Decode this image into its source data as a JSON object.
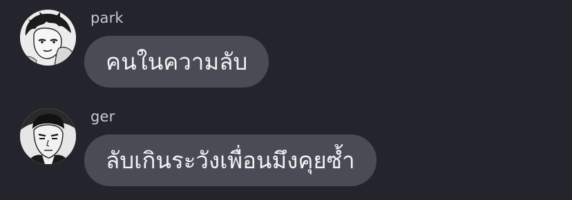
{
  "messages": [
    {
      "sender": "park",
      "text": "คนในความลับ",
      "avatar_icon": "manga-boy-avatar-icon"
    },
    {
      "sender": "ger",
      "text": "ลับเกินระวังเพื่อนมึงคุยซ้ำ",
      "avatar_icon": "manga-man-avatar-icon"
    }
  ],
  "colors": {
    "background": "#24252c",
    "bubble": "#4a4c55",
    "sender_text": "#c9cad0",
    "message_text": "#f2f2f4"
  }
}
